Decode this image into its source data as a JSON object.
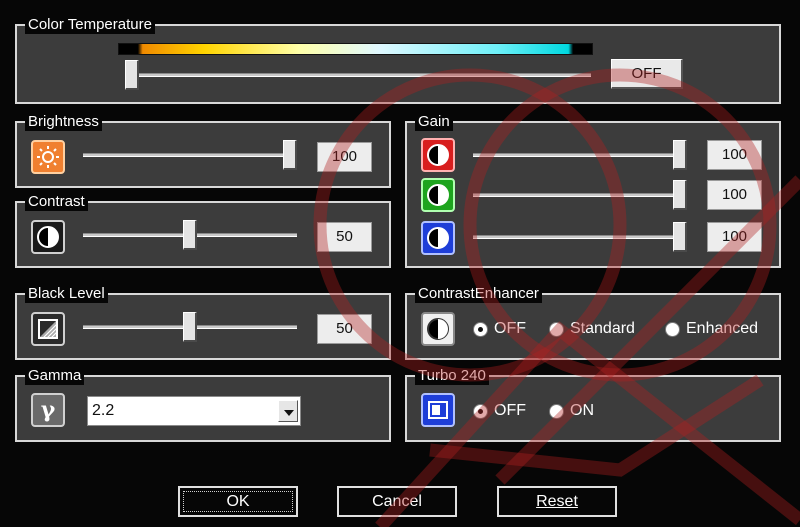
{
  "color_temperature": {
    "legend": "Color Temperature",
    "button": "OFF",
    "level": 0.0
  },
  "brightness": {
    "legend": "Brightness",
    "value": "100",
    "level": 1.0,
    "icon": "sun-icon"
  },
  "contrast": {
    "legend": "Contrast",
    "value": "50",
    "level": 0.5,
    "icon": "contrast-icon"
  },
  "gain": {
    "legend": "Gain",
    "channels": [
      {
        "color": "#e02020",
        "value": "100",
        "level": 1.0,
        "icon": "red-gain-icon"
      },
      {
        "color": "#20b020",
        "value": "100",
        "level": 1.0,
        "icon": "green-gain-icon"
      },
      {
        "color": "#2040e0",
        "value": "100",
        "level": 1.0,
        "icon": "blue-gain-icon"
      }
    ]
  },
  "black_level": {
    "legend": "Black Level",
    "value": "50",
    "level": 0.5,
    "icon": "black-level-icon"
  },
  "contrast_enhancer": {
    "legend": "ContrastEnhancer",
    "options": [
      "OFF",
      "Standard",
      "Enhanced"
    ],
    "selected": "OFF"
  },
  "gamma": {
    "legend": "Gamma",
    "value": "2.2",
    "icon": "gamma-icon"
  },
  "turbo": {
    "legend": "Turbo 240",
    "options": [
      "OFF",
      "ON"
    ],
    "selected": "OFF"
  },
  "buttons": {
    "ok": "OK",
    "cancel": "Cancel",
    "reset": "Reset"
  },
  "colors": {
    "background": "#060606",
    "panel": "#3c3c3c",
    "border": "#d8d8d8",
    "watermark": "#b02020"
  }
}
